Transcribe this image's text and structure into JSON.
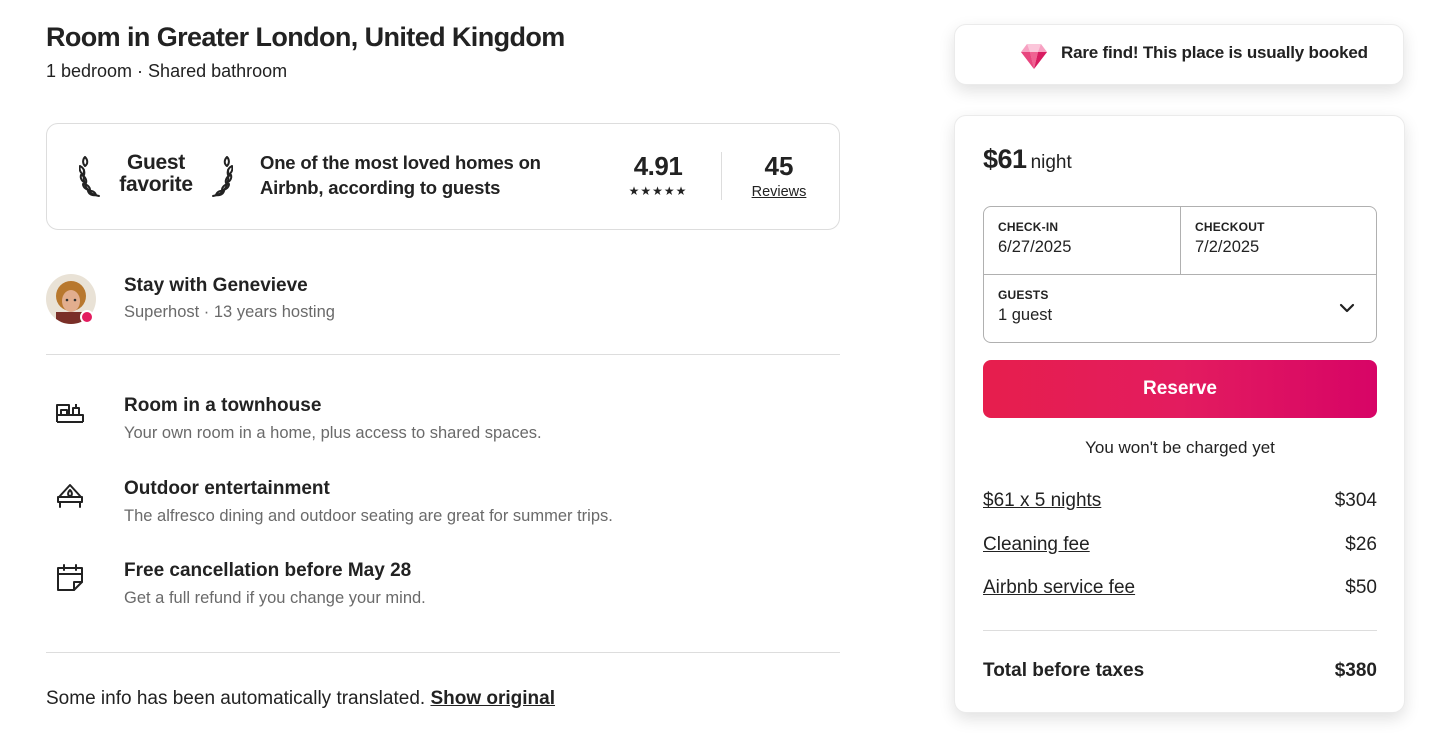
{
  "listing": {
    "title": "Room in Greater London, United Kingdom",
    "subtitle": "1 bedroom · Shared bathroom"
  },
  "guest_favorite": {
    "badge_line1": "Guest",
    "badge_line2": "favorite",
    "description": "One of the most loved homes on Airbnb, according to guests",
    "rating": "4.91",
    "stars": "★★★★★",
    "reviews_count": "45",
    "reviews_label": "Reviews"
  },
  "host": {
    "name": "Stay with Genevieve",
    "details": "Superhost · 13 years hosting"
  },
  "features": [
    {
      "icon": "bed-icon",
      "title": "Room in a townhouse",
      "description": "Your own room in a home, plus access to shared spaces."
    },
    {
      "icon": "outdoor-icon",
      "title": "Outdoor entertainment",
      "description": "The alfresco dining and outdoor seating are great for summer trips."
    },
    {
      "icon": "calendar-icon",
      "title": "Free cancellation before May 28",
      "description": "Get a full refund if you change your mind."
    }
  ],
  "translation": {
    "text": "Some info has been automatically translated.",
    "link": "Show original"
  },
  "rare_find": {
    "text": "Rare find! This place is usually booked"
  },
  "booking": {
    "price": "$61",
    "per": "night",
    "checkin_label": "CHECK-IN",
    "checkin_value": "6/27/2025",
    "checkout_label": "CHECKOUT",
    "checkout_value": "7/2/2025",
    "guests_label": "GUESTS",
    "guests_value": "1 guest",
    "reserve_label": "Reserve",
    "no_charge": "You won't be charged yet",
    "lines": [
      {
        "label": "$61 x 5 nights",
        "value": "$304"
      },
      {
        "label": "Cleaning fee",
        "value": "$26"
      },
      {
        "label": "Airbnb service fee",
        "value": "$50"
      }
    ],
    "total_label": "Total before taxes",
    "total_value": "$380"
  },
  "colors": {
    "brand": "#e31c5f",
    "text": "#222222",
    "muted": "#6a6a6a",
    "border": "#dddddd"
  }
}
